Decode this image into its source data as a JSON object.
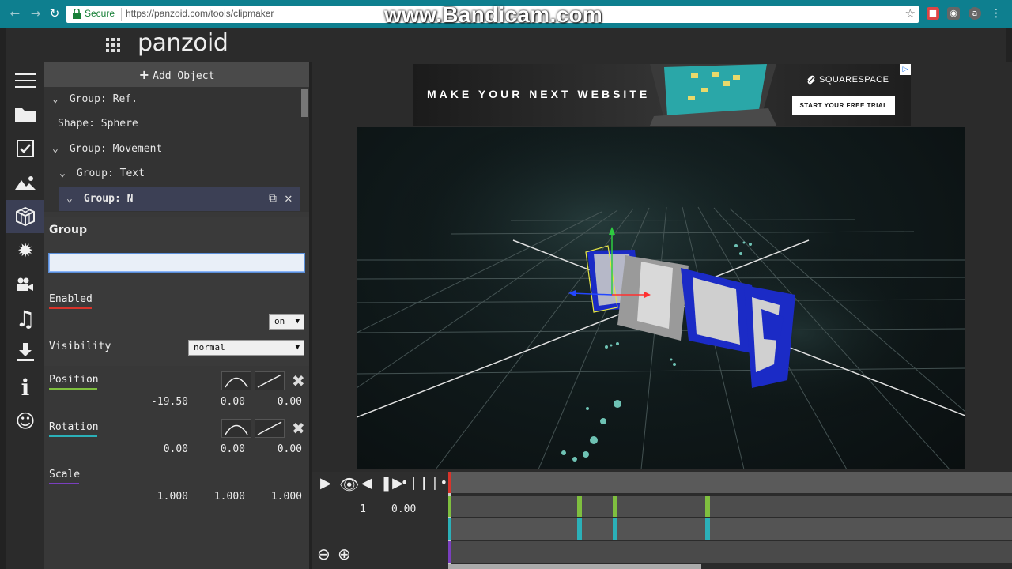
{
  "browser": {
    "secure_label": "Secure",
    "url": "https://panzoid.com/tools/clipmaker",
    "watermark": "www.Bandicam.com"
  },
  "app": {
    "logo": "panzoid"
  },
  "sidebar": {
    "icons": [
      "menu-icon",
      "folder-icon",
      "checkbox-icon",
      "image-icon",
      "3d-cube-icon",
      "burst-icon",
      "camera-icon",
      "music-icon",
      "download-icon",
      "info-icon",
      "smiley-icon"
    ],
    "active_index": 4
  },
  "objects": {
    "add_label": "Add Object",
    "tree": [
      {
        "label": "Group: Ref.",
        "expanded": true,
        "indent": 0
      },
      {
        "label": "Shape: Sphere",
        "expanded": null,
        "indent": 0
      },
      {
        "label": "Group: Movement",
        "expanded": true,
        "indent": 0
      },
      {
        "label": "Group: Text",
        "expanded": true,
        "indent": 1
      },
      {
        "label": "Group: N",
        "expanded": true,
        "indent": 2,
        "selected": true
      }
    ]
  },
  "properties": {
    "section_title": "Group",
    "name_value": "",
    "enabled_label": "Enabled",
    "enabled_value": "on",
    "visibility_label": "Visibility",
    "visibility_value": "normal",
    "position": {
      "label": "Position",
      "x": "-19.50",
      "y": "0.00",
      "z": "0.00"
    },
    "rotation": {
      "label": "Rotation",
      "x": "0.00",
      "y": "0.00",
      "z": "0.00"
    },
    "scale": {
      "label": "Scale",
      "x": "1.000",
      "y": "1.000",
      "z": "1.000"
    }
  },
  "colors": {
    "enabled_underline": "#d9342b",
    "position_underline": "#7fbf3f",
    "rotation_underline": "#2bb0b8",
    "scale_underline": "#7a3fbf",
    "accent": "#3c4055"
  },
  "ad": {
    "headline": "MAKE YOUR NEXT WEBSITE",
    "brand": "SQUARESPACE",
    "cta": "START YOUR FREE TRIAL"
  },
  "timeline": {
    "frame": "1",
    "time": "0.00",
    "controls": [
      "play-icon",
      "eye-icon",
      "volume-icon",
      "step-icon",
      "waveform-icon"
    ],
    "zoom": [
      "zoom-out-icon",
      "zoom-in-icon"
    ]
  }
}
